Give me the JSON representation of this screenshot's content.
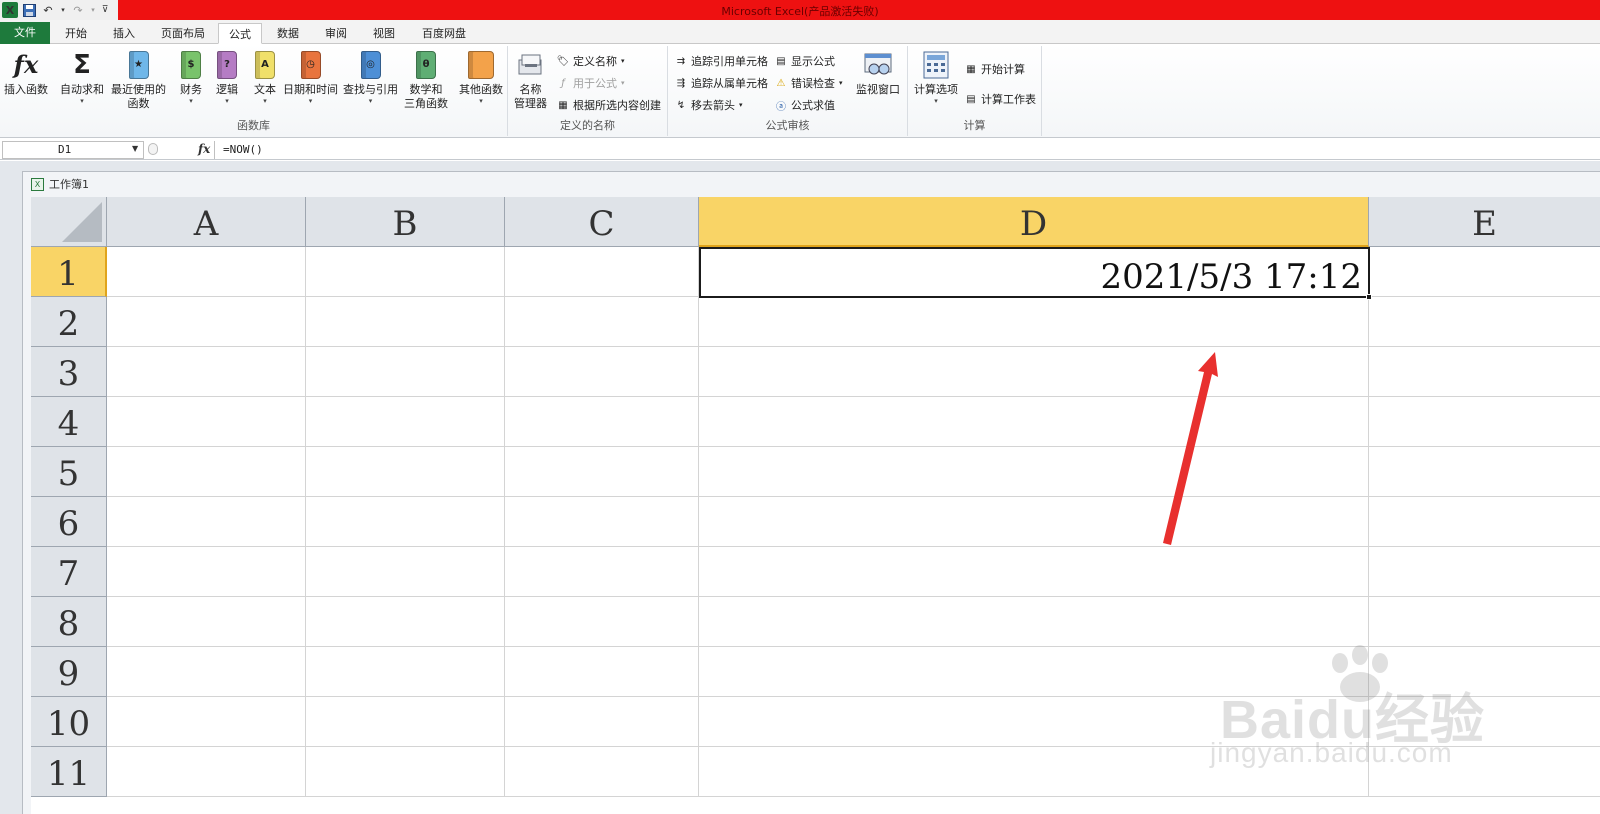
{
  "window": {
    "title": "Microsoft Excel(产品激活失败)"
  },
  "tabs": [
    {
      "label": "文件"
    },
    {
      "label": "开始"
    },
    {
      "label": "插入"
    },
    {
      "label": "页面布局"
    },
    {
      "label": "公式"
    },
    {
      "label": "数据"
    },
    {
      "label": "审阅"
    },
    {
      "label": "视图"
    },
    {
      "label": "百度网盘"
    }
  ],
  "active_tab": "公式",
  "ribbon": {
    "function_library": {
      "label": "函数库",
      "insert_function": "插入函数",
      "autosum": "自动求和",
      "recent_line1": "最近使用的",
      "recent_line2": "函数",
      "financial": "财务",
      "logical": "逻辑",
      "text": "文本",
      "datetime": "日期和时间",
      "lookup": "查找与引用",
      "math_line1": "数学和",
      "math_line2": "三角函数",
      "more": "其他函数"
    },
    "defined_names": {
      "label": "定义的名称",
      "name_manager_line1": "名称",
      "name_manager_line2": "管理器",
      "define_name": "定义名称",
      "use_in_formula": "用于公式",
      "create_from_selection": "根据所选内容创建"
    },
    "formula_auditing": {
      "label": "公式审核",
      "trace_precedents": "追踪引用单元格",
      "trace_dependents": "追踪从属单元格",
      "remove_arrows": "移去箭头",
      "show_formulas": "显示公式",
      "error_checking": "错误检查",
      "evaluate_formula": "公式求值",
      "watch_window": "监视窗口"
    },
    "calculation": {
      "label": "计算",
      "calc_options": "计算选项",
      "calc_now": "开始计算",
      "calc_sheet": "计算工作表"
    }
  },
  "formula_bar": {
    "name_box": "D1",
    "fx": "fx",
    "formula": "=NOW()"
  },
  "workbook": {
    "title": "工作簿1"
  },
  "sheet": {
    "columns": [
      "A",
      "B",
      "C",
      "D",
      "E"
    ],
    "rows": [
      "1",
      "2",
      "3",
      "4",
      "5",
      "6",
      "7",
      "8",
      "9",
      "10",
      "11"
    ],
    "selected_column": "D",
    "selected_row": "1",
    "cells": {
      "D1": "2021/5/3  17:12"
    }
  },
  "watermark": {
    "brand": "Baidu经验",
    "url": "jingyan.baidu.com"
  },
  "colors": {
    "title_bar": "#ee1111",
    "file_tab": "#1e7a3c",
    "selected_header": "#f9d466",
    "annotation_arrow": "#e8302e"
  }
}
